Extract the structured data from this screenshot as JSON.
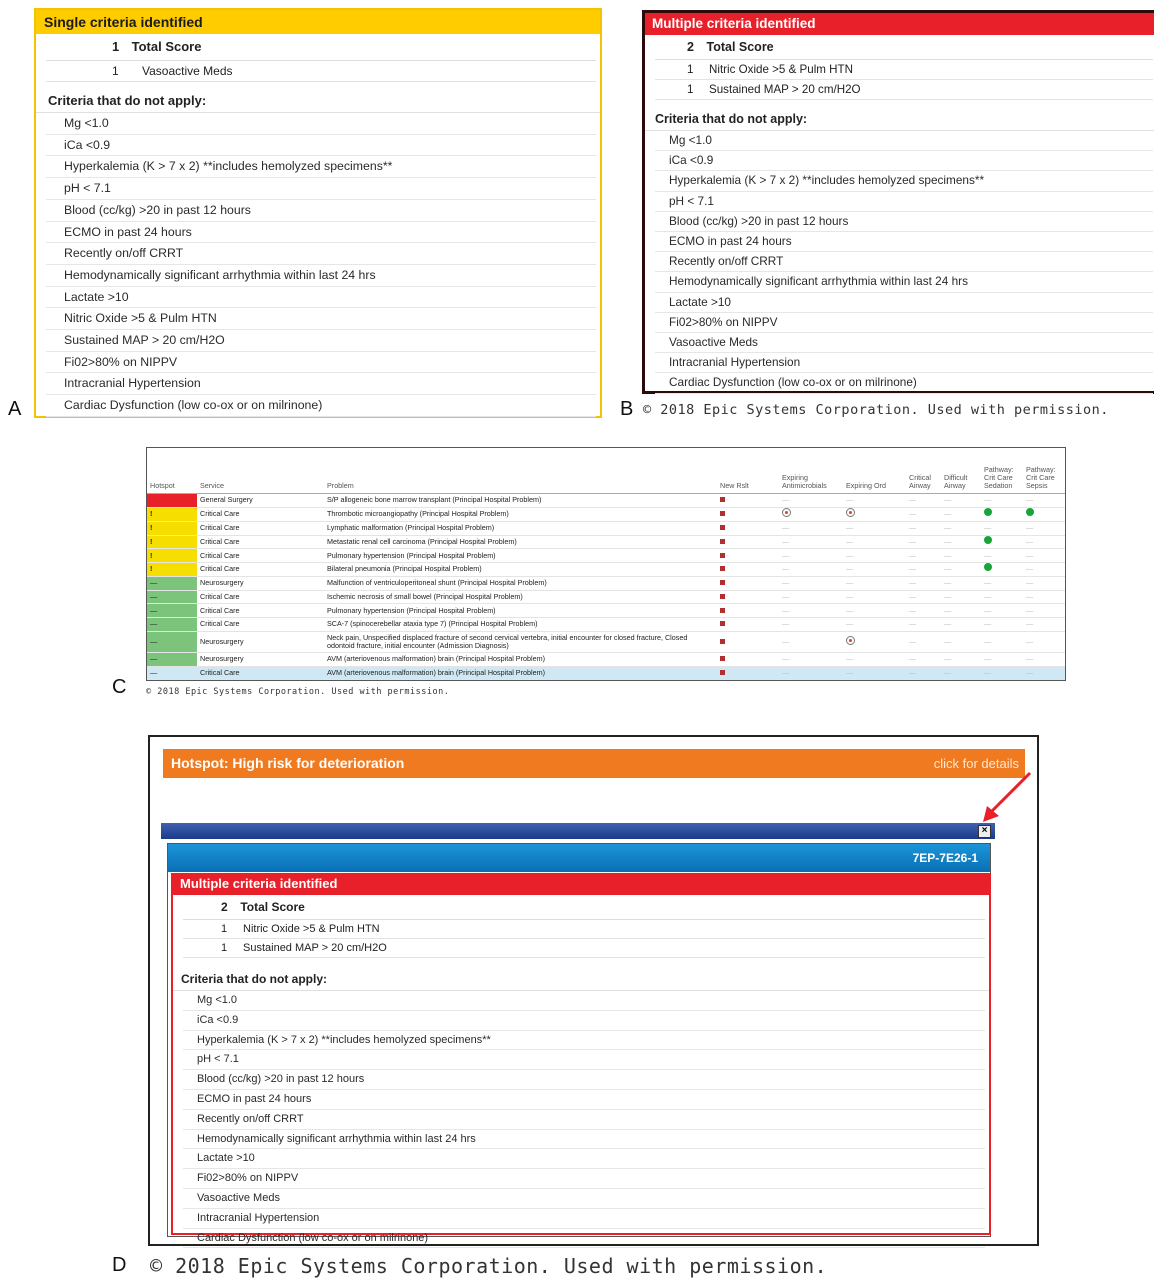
{
  "panel_labels": {
    "a": "A",
    "b": "B",
    "c": "C",
    "d": "D"
  },
  "copyright": "© 2018 Epic Systems Corporation. Used with permission.",
  "panel_a": {
    "header": "Single criteria identified",
    "total_num": "1",
    "total_label": "Total Score",
    "met": [
      {
        "num": "1",
        "label": "Vasoactive Meds"
      }
    ],
    "section_title": "Criteria that do not apply:",
    "items": [
      "Mg <1.0",
      "iCa <0.9",
      "Hyperkalemia (K > 7 x 2) **includes hemolyzed specimens**",
      "pH < 7.1",
      "Blood (cc/kg) >20 in past 12 hours",
      "ECMO in past 24 hours",
      "Recently on/off CRRT",
      "Hemodynamically significant arrhythmia within last 24 hrs",
      "Lactate >10",
      "Nitric Oxide >5 & Pulm HTN",
      "Sustained MAP > 20 cm/H2O",
      "Fi02>80% on NIPPV",
      "Intracranial Hypertension",
      "Cardiac Dysfunction (low co-ox or on milrinone)"
    ]
  },
  "panel_b": {
    "header": "Multiple criteria identified",
    "total_num": "2",
    "total_label": "Total Score",
    "met": [
      {
        "num": "1",
        "label": "Nitric Oxide >5 & Pulm HTN"
      },
      {
        "num": "1",
        "label": "Sustained MAP > 20 cm/H2O"
      }
    ],
    "section_title": "Criteria that do not apply:",
    "items": [
      "Mg <1.0",
      "iCa <0.9",
      "Hyperkalemia (K > 7 x 2) **includes hemolyzed specimens**",
      "pH < 7.1",
      "Blood (cc/kg) >20 in past 12 hours",
      "ECMO in past 24 hours",
      "Recently on/off CRRT",
      "Hemodynamically significant arrhythmia within last 24 hrs",
      "Lactate >10",
      "Fi02>80% on NIPPV",
      "Vasoactive Meds",
      "Intracranial Hypertension",
      "Cardiac Dysfunction (low co-ox or on milrinone)"
    ]
  },
  "panel_c": {
    "columns": [
      "Hotspot",
      "Service",
      "Problem",
      "New Rslt",
      "Expiring Antimicrobials",
      "Expiring Ord",
      "Critical Airway",
      "Difficult Airway",
      "Pathway: Crit Care Sedation",
      "Pathway: Crit Care Sepsis"
    ],
    "rows": [
      {
        "hotspot": "red",
        "hs_text": "",
        "service": "General Surgery",
        "problem": "S/P allogeneic bone marrow transplant (Principal Hospital Problem)",
        "antimicro": "",
        "ord": "",
        "sedation": false,
        "sepsis": false,
        "tall": false,
        "selected": false
      },
      {
        "hotspot": "yellow",
        "hs_text": "!",
        "service": "Critical Care",
        "problem": "Thrombotic microangiopathy (Principal Hospital Problem)",
        "antimicro": "mag",
        "ord": "mag",
        "sedation": true,
        "sepsis": true,
        "tall": false,
        "selected": false
      },
      {
        "hotspot": "yellow",
        "hs_text": "!",
        "service": "Critical Care",
        "problem": "Lymphatic malformation (Principal Hospital Problem)",
        "antimicro": "",
        "ord": "",
        "sedation": false,
        "sepsis": false,
        "tall": false,
        "selected": false
      },
      {
        "hotspot": "yellow",
        "hs_text": "!",
        "service": "Critical Care",
        "problem": "Metastatic renal cell carcinoma (Principal Hospital Problem)",
        "antimicro": "",
        "ord": "",
        "sedation": true,
        "sepsis": false,
        "tall": false,
        "selected": false
      },
      {
        "hotspot": "yellow",
        "hs_text": "!",
        "service": "Critical Care",
        "problem": "Pulmonary hypertension (Principal Hospital Problem)",
        "antimicro": "",
        "ord": "",
        "sedation": false,
        "sepsis": false,
        "tall": false,
        "selected": false
      },
      {
        "hotspot": "yellow",
        "hs_text": "!",
        "service": "Critical Care",
        "problem": "Bilateral pneumonia (Principal Hospital Problem)",
        "antimicro": "",
        "ord": "",
        "sedation": true,
        "sepsis": false,
        "tall": false,
        "selected": false
      },
      {
        "hotspot": "green",
        "hs_text": "—",
        "service": "Neurosurgery",
        "problem": "Malfunction of ventriculoperitoneal shunt (Principal Hospital Problem)",
        "antimicro": "",
        "ord": "",
        "sedation": false,
        "sepsis": false,
        "tall": false,
        "selected": false
      },
      {
        "hotspot": "green",
        "hs_text": "—",
        "service": "Critical Care",
        "problem": "Ischemic necrosis of small bowel (Principal Hospital Problem)",
        "antimicro": "",
        "ord": "",
        "sedation": false,
        "sepsis": false,
        "tall": false,
        "selected": false
      },
      {
        "hotspot": "green",
        "hs_text": "—",
        "service": "Critical Care",
        "problem": "Pulmonary hypertension (Principal Hospital Problem)",
        "antimicro": "",
        "ord": "",
        "sedation": false,
        "sepsis": false,
        "tall": false,
        "selected": false
      },
      {
        "hotspot": "green",
        "hs_text": "—",
        "service": "Critical Care",
        "problem": "SCA-7 (spinocerebellar ataxia type 7) (Principal Hospital Problem)",
        "antimicro": "",
        "ord": "",
        "sedation": false,
        "sepsis": false,
        "tall": false,
        "selected": false
      },
      {
        "hotspot": "green",
        "hs_text": "—",
        "service": "Neurosurgery",
        "problem": "Neck pain, Unspecified displaced fracture of second cervical vertebra, initial encounter for closed fracture, Closed odontoid fracture, initial encounter (Admission Diagnosis)",
        "antimicro": "",
        "ord": "mag",
        "sedation": false,
        "sepsis": false,
        "tall": true,
        "selected": false
      },
      {
        "hotspot": "green",
        "hs_text": "—",
        "service": "Neurosurgery",
        "problem": "AVM (arteriovenous malformation) brain (Principal Hospital Problem)",
        "antimicro": "",
        "ord": "",
        "sedation": false,
        "sepsis": false,
        "tall": false,
        "selected": false
      },
      {
        "hotspot": "green",
        "hs_text": "—",
        "service": "Critical Care",
        "problem": "AVM (arteriovenous malformation) brain (Principal Hospital Problem)",
        "antimicro": "",
        "ord": "",
        "sedation": false,
        "sepsis": false,
        "tall": false,
        "selected": true
      }
    ]
  },
  "panel_d": {
    "banner_title": "Hotspot: High risk for deterioration",
    "banner_link": "click for details",
    "close_glyph": "×",
    "location": "7EP-7E26-1",
    "header": "Multiple criteria identified",
    "total_num": "2",
    "total_label": "Total Score",
    "met": [
      {
        "num": "1",
        "label": "Nitric Oxide >5 & Pulm HTN"
      },
      {
        "num": "1",
        "label": "Sustained MAP > 20 cm/H2O"
      }
    ],
    "section_title": "Criteria that do not apply:",
    "items": [
      "Mg <1.0",
      "iCa <0.9",
      "Hyperkalemia (K > 7 x 2) **includes hemolyzed specimens**",
      "pH < 7.1",
      "Blood (cc/kg) >20 in past 12 hours",
      "ECMO in past 24 hours",
      "Recently on/off CRRT",
      "Hemodynamically significant arrhythmia within last 24 hrs",
      "Lactate >10",
      "Fi02>80% on NIPPV",
      "Vasoactive Meds",
      "Intracranial Hypertension",
      "Cardiac Dysfunction (low co-ox or on milrinone)"
    ]
  },
  "colors": {
    "yellow_header": "#ffcc00",
    "red_header": "#e8202a",
    "orange_banner": "#f07a20",
    "status_green": "#17a53a"
  }
}
